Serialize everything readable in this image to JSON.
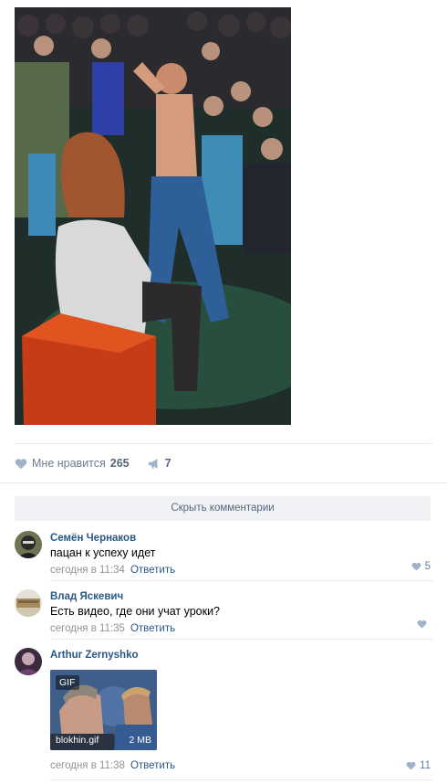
{
  "post": {
    "photo_icon": "photo-image",
    "likes_label": "Мне нравится",
    "likes_count": "265",
    "shares_count": "7"
  },
  "comments_toggle": "Скрыть комментарии",
  "comments": [
    {
      "author": "Семён Чернаков",
      "text": "пацан к успеху идет",
      "time": "сегодня в 11:34",
      "reply": "Ответить",
      "likes": "5"
    },
    {
      "author": "Влад Яскевич",
      "text": "Есть видео, где они учат уроки?",
      "time": "сегодня в 11:35",
      "reply": "Ответить",
      "likes": ""
    },
    {
      "author": "Arthur Zernyshko",
      "time": "сегодня в 11:38",
      "reply": "Ответить",
      "likes": "11",
      "attachment": {
        "badge": "GIF",
        "filename": "blokhin.gif",
        "size": "2 MB"
      }
    }
  ],
  "colors": {
    "link": "#2a5885",
    "muted": "#939393",
    "action": "#6b7d8f",
    "bar_bg": "#f0f2f5"
  }
}
